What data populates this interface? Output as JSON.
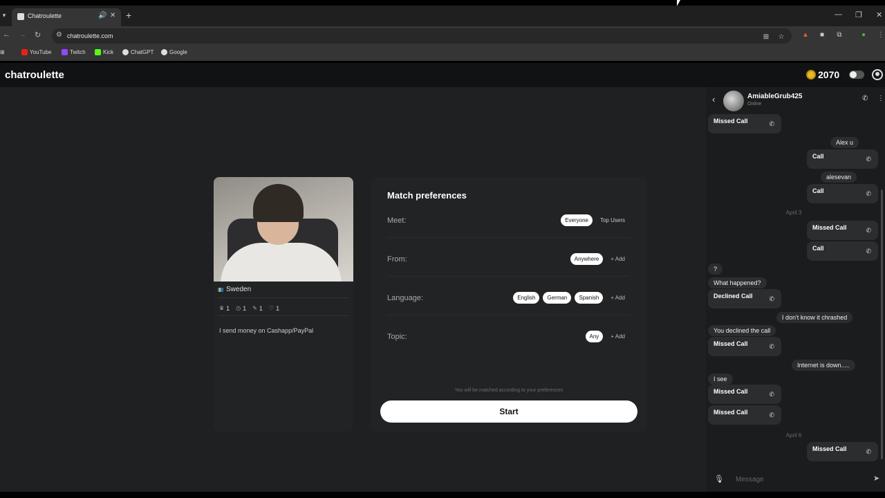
{
  "browser": {
    "tab_title": "Chatroulette",
    "url": "chatroulette.com",
    "bookmarks": [
      "YouTube",
      "Twitch",
      "Kick",
      "ChatGPT",
      "Google"
    ],
    "colors": {
      "youtube": "#e62117",
      "twitch": "#9146ff",
      "kick": "#53fc18",
      "chatgpt": "#dddddd",
      "google": "#dddddd"
    }
  },
  "header": {
    "logo": "chatroulette",
    "coins": "2070"
  },
  "profile_card": {
    "country": "Sweden",
    "stats": [
      "1",
      "1",
      "1",
      "1"
    ],
    "bio": "I send money on Cashapp/PayPal"
  },
  "preferences": {
    "title": "Match preferences",
    "meet": {
      "label": "Meet:",
      "chips": [
        "Everyone",
        "Top Users"
      ]
    },
    "from": {
      "label": "From:",
      "chips": [
        "Anywhere"
      ],
      "add": "+ Add"
    },
    "language": {
      "label": "Language:",
      "chips": [
        "English",
        "German",
        "Spanish"
      ],
      "add": "+ Add"
    },
    "topic": {
      "label": "Topic:",
      "chips": [
        "Any"
      ],
      "add": "+ Add"
    },
    "hint": "You will be matched according to your preferences",
    "start": "Start"
  },
  "chat": {
    "name": "AmiableGrub425",
    "status": "Online",
    "messages": {
      "m1": "Missed Call",
      "m2": "Alex u",
      "m3": "Call",
      "m4": "alesevan",
      "m5": "Call",
      "date1": "April 3",
      "m6": "Missed Call",
      "m7": "Call",
      "m8": "?",
      "m9": "What happened?",
      "m10": "Declined Call",
      "m11": "I don't know it chrashed",
      "m12": "You declined the call",
      "m13": "Missed Call",
      "m14": "Internet is down.....",
      "m15": "I see",
      "m16": "Missed Call",
      "m17": "Missed Call",
      "date2": "April 6",
      "m18": "Missed Call"
    },
    "placeholder": "Message"
  }
}
